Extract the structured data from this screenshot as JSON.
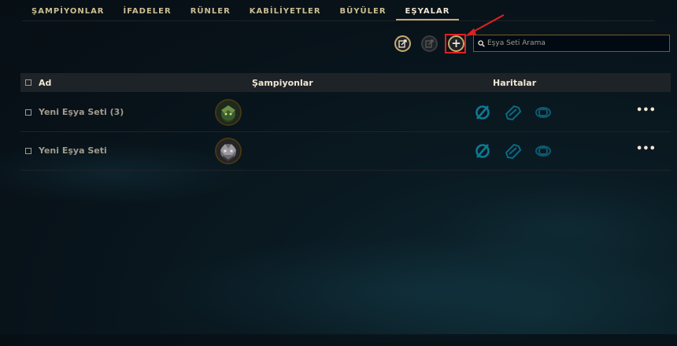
{
  "tabs": [
    {
      "label": "ŞAMPİYONLAR"
    },
    {
      "label": "İFADELER"
    },
    {
      "label": "RÜNLER"
    },
    {
      "label": "KABİLİYETLER"
    },
    {
      "label": "BÜYÜLER"
    },
    {
      "label": "EŞYALAR",
      "active": true
    }
  ],
  "toolbar": {
    "import_icon": "import-icon",
    "export_icon": "export-icon",
    "add_label": "+",
    "search_placeholder": "Eşya Seti Arama"
  },
  "table": {
    "headers": {
      "name": "Ad",
      "champions": "Şampiyonlar",
      "maps": "Haritalar"
    },
    "rows": [
      {
        "name": "Yeni Eşya Seti (3)",
        "champion_icon": "champion-avatar-green",
        "maps": [
          "all-maps-icon",
          "summoners-rift-icon",
          "howling-abyss-icon"
        ],
        "more": "•••"
      },
      {
        "name": "Yeni Eşya Seti",
        "champion_icon": "champion-avatar-grey",
        "maps": [
          "all-maps-icon",
          "summoners-rift-icon",
          "howling-abyss-icon"
        ],
        "more": "•••"
      }
    ]
  },
  "colors": {
    "gold": "#c8aa6e",
    "teal_icon": "#0a7b95",
    "annotation_red": "#e02020"
  }
}
